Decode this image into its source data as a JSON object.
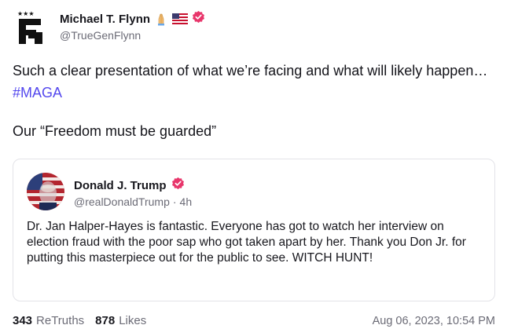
{
  "post": {
    "author_name": "Michael T. Flynn",
    "author_emojis": [
      "folded-hands-emoji",
      "us-flag-emoji"
    ],
    "author_handle": "@TrueGenFlynn",
    "text_line1": "Such a clear presentation of what we’re facing and what will likely happen… ",
    "hashtag": "#MAGA",
    "text_line2": "Our “Freedom must be guarded”",
    "colors": {
      "hashtag": "#5448ee",
      "verified": "#e8366b",
      "muted": "#6b6b76"
    }
  },
  "quote": {
    "author_name": "Donald J. Trump",
    "author_handle": "@realDonaldTrump",
    "separator": "·",
    "age": "4h",
    "text": "Dr. Jan Halper-Hayes is fantastic. Everyone has got to watch her interview on election fraud with the poor sap who got taken apart by her. Thank you Don Jr. for putting this masterpiece out for the public to see. WITCH HUNT!"
  },
  "footer": {
    "retruths_count": "343",
    "retruths_label": "ReTruths",
    "likes_count": "878",
    "likes_label": "Likes",
    "timestamp": "Aug 06, 2023, 10:54 PM"
  }
}
